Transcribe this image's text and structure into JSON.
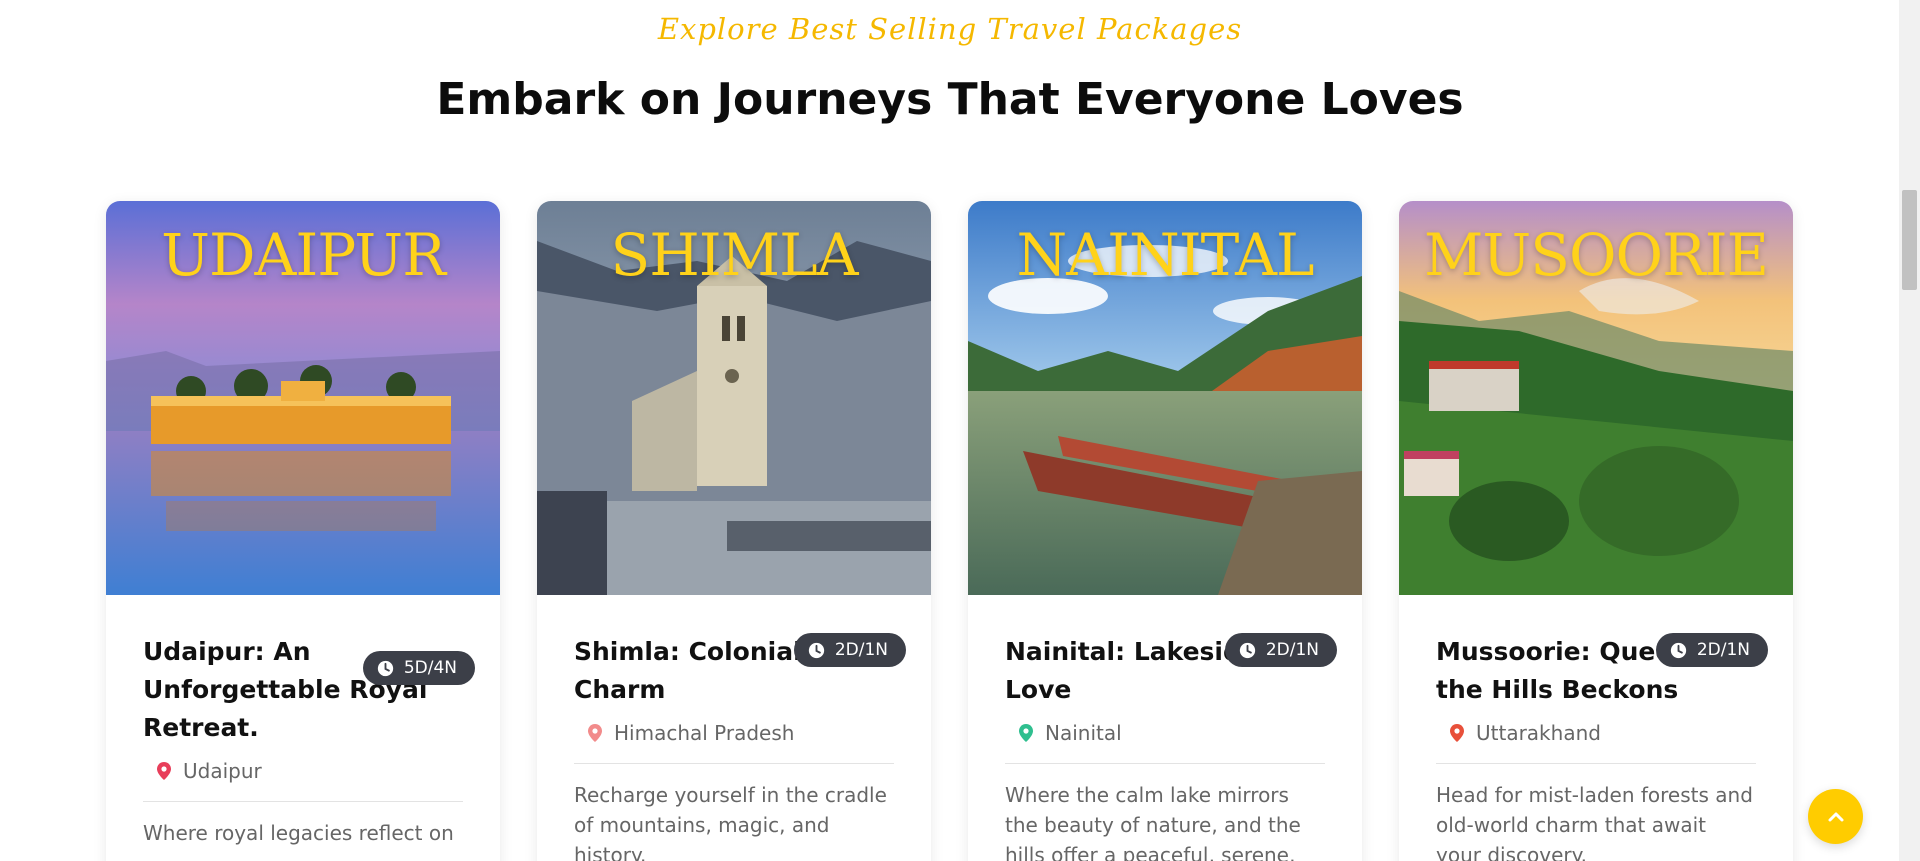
{
  "section": {
    "eyebrow": "Explore Best Selling Travel Packages",
    "heading": "Embark on Journeys That Everyone Loves"
  },
  "packages": [
    {
      "city_label": "UDAIPUR",
      "title": "Udaipur: An Unforgettable Royal Retreat.",
      "duration": "5D/4N",
      "location": "Udaipur",
      "pin_color": "#e83e5a",
      "description": "Where royal legacies reflect on"
    },
    {
      "city_label": "SHIMLA",
      "title": "Shimla: Colonial Charm",
      "duration": "2D/1N",
      "location": "Himachal Pradesh",
      "pin_color": "#f28b8b",
      "description": "Recharge yourself in the cradle of mountains, magic, and history."
    },
    {
      "city_label": "NAINITAL",
      "title": "Nainital: Lakeside Love",
      "duration": "2D/1N",
      "location": "Nainital",
      "pin_color": "#2fbf8f",
      "description": "Where the calm lake mirrors the beauty of nature, and the hills offer a peaceful, serene, and soulful break."
    },
    {
      "city_label": "MUSOORIE",
      "title": "Mussoorie: Queen of the Hills Beckons",
      "duration": "2D/1N",
      "location": "Uttarakhand",
      "pin_color": "#e8503a",
      "description": "Head for mist-laden forests and old-world charm that await your discovery."
    }
  ],
  "colors": {
    "accent": "#ffcc00",
    "badge_bg": "#3c3f48"
  },
  "icons": {
    "duration": "clock-icon",
    "location": "map-pin-icon",
    "back_to_top": "chevron-up-icon"
  }
}
